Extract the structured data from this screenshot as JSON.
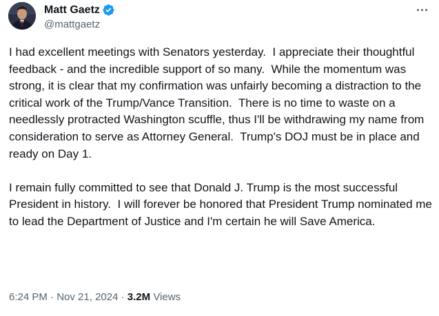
{
  "author": {
    "display_name": "Matt Gaetz",
    "handle": "@mattgaetz",
    "verified": true,
    "verified_color": "#1d9bf0"
  },
  "tweet": {
    "paragraphs": [
      "I had excellent meetings with Senators yesterday.  I appreciate their thoughtful feedback - and the incredible support of so many.  While the momentum was strong, it is clear that my confirmation was unfairly becoming a distraction to the critical work of the Trump/Vance Transition.  There is no time to waste on a needlessly protracted Washington scuffle, thus I'll be withdrawing my name from consideration to serve as Attorney General.  Trump's DOJ must be in place and ready on Day 1.",
      "I remain fully committed to see that Donald J. Trump is the most successful President in history.  I will forever be honored that President Trump nominated me to lead the Department of Justice and I'm certain he will Save America."
    ]
  },
  "meta": {
    "time": "6:24 PM",
    "separator": " · ",
    "date": "Nov 21, 2024",
    "views_count": "3.2M",
    "views_label": "Views"
  },
  "icons": {
    "more": "more-horizontal-icon",
    "verified": "verified-badge-icon"
  },
  "colors": {
    "text_primary": "#0f1419",
    "text_secondary": "#536471"
  }
}
